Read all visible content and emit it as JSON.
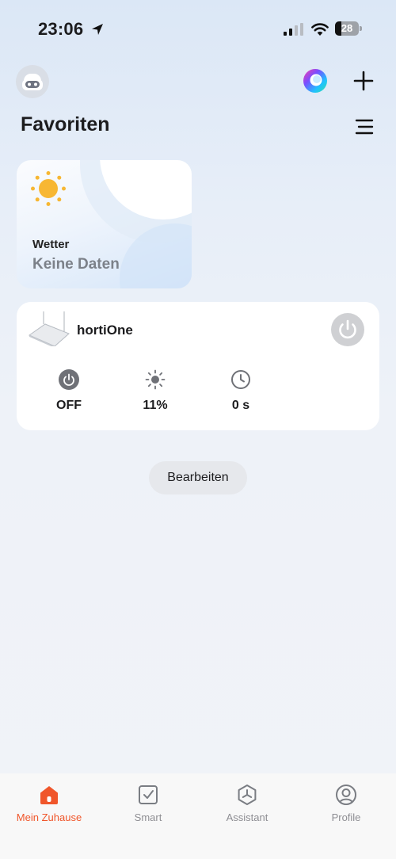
{
  "status_bar": {
    "time": "23:06",
    "battery_level": "28",
    "icons": [
      "location-arrow-icon",
      "cellular-signal-icon",
      "wifi-icon",
      "battery-icon"
    ]
  },
  "header": {
    "title": "Favoriten",
    "icons": [
      "avatar-robot-icon",
      "siri-icon",
      "plus-icon",
      "list-menu-icon"
    ]
  },
  "weather_card": {
    "label": "Wetter",
    "value": "Keine Daten",
    "icon": "sun-icon"
  },
  "device_card": {
    "name": "hortiOne",
    "power_icon": "power-icon",
    "stats": [
      {
        "icon": "power-icon",
        "value": "OFF"
      },
      {
        "icon": "brightness-icon",
        "value": "11%"
      },
      {
        "icon": "clock-icon",
        "value": "0 s"
      }
    ]
  },
  "edit_button": "Bearbeiten",
  "tab_bar": {
    "tabs": [
      {
        "label": "Mein Zuhause",
        "icon": "home-icon",
        "active": true
      },
      {
        "label": "Smart",
        "icon": "checkbox-icon",
        "active": false
      },
      {
        "label": "Assistant",
        "icon": "assistant-icon",
        "active": false
      },
      {
        "label": "Profile",
        "icon": "profile-icon",
        "active": false
      }
    ],
    "active_color": "#f0562b",
    "inactive_color": "#8e8e93"
  }
}
